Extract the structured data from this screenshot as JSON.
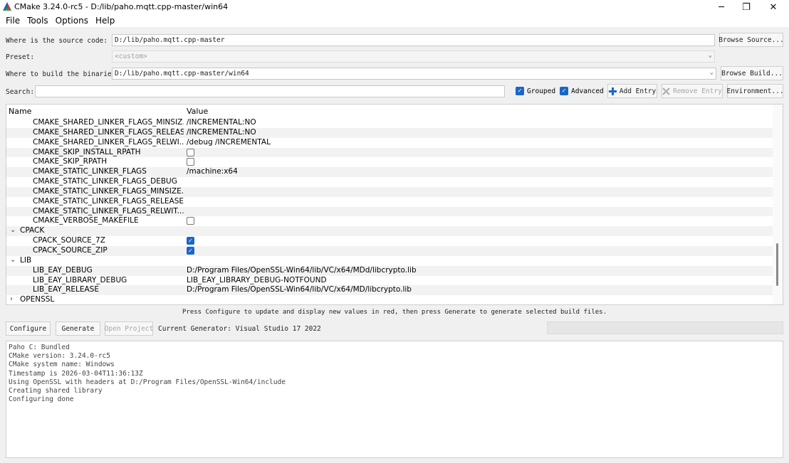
{
  "window": {
    "title": "CMake 3.24.0-rc5 - D:/lib/paho.mqtt.cpp-master/win64",
    "min_glyph": "─",
    "max_glyph": "❐",
    "close_glyph": "✕"
  },
  "menu": [
    "File",
    "Tools",
    "Options",
    "Help"
  ],
  "source": {
    "label": "Where is the source code:",
    "value": "D:/lib/paho.mqtt.cpp-master",
    "button": "Browse Source..."
  },
  "preset": {
    "label": "Preset:",
    "value": "<custom>"
  },
  "build": {
    "label": "Where to build the binaries:",
    "value": "D:/lib/paho.mqtt.cpp-master/win64",
    "button": "Browse Build..."
  },
  "search": {
    "label": "Search:",
    "value": ""
  },
  "toggles": {
    "grouped": "Grouped",
    "advanced": "Advanced"
  },
  "toolbar": {
    "add_entry": "Add Entry",
    "remove_entry": "Remove Entry",
    "environment": "Environment..."
  },
  "table": {
    "header_name": "Name",
    "header_value": "Value",
    "rows": [
      {
        "name": "CMAKE_SHARED_LINKER_FLAGS_MINSIZ...",
        "value": "/INCREMENTAL:NO"
      },
      {
        "name": "CMAKE_SHARED_LINKER_FLAGS_RELEASE",
        "value": "/INCREMENTAL:NO"
      },
      {
        "name": "CMAKE_SHARED_LINKER_FLAGS_RELWI...",
        "value": "/debug /INCREMENTAL"
      },
      {
        "name": "CMAKE_SKIP_INSTALL_RPATH",
        "checkbox": false
      },
      {
        "name": "CMAKE_SKIP_RPATH",
        "checkbox": false
      },
      {
        "name": "CMAKE_STATIC_LINKER_FLAGS",
        "value": "/machine:x64"
      },
      {
        "name": "CMAKE_STATIC_LINKER_FLAGS_DEBUG",
        "value": ""
      },
      {
        "name": "CMAKE_STATIC_LINKER_FLAGS_MINSIZE...",
        "value": ""
      },
      {
        "name": "CMAKE_STATIC_LINKER_FLAGS_RELEASE",
        "value": ""
      },
      {
        "name": "CMAKE_STATIC_LINKER_FLAGS_RELWIT...",
        "value": ""
      },
      {
        "name": "CMAKE_VERBOSE_MAKEFILE",
        "checkbox": false
      },
      {
        "name": "CPACK",
        "group": true,
        "expanded": true
      },
      {
        "name": "CPACK_SOURCE_7Z",
        "checkbox": true
      },
      {
        "name": "CPACK_SOURCE_ZIP",
        "checkbox": true
      },
      {
        "name": "LIB",
        "group": true,
        "expanded": true
      },
      {
        "name": "LIB_EAY_DEBUG",
        "value": "D:/Program Files/OpenSSL-Win64/lib/VC/x64/MDd/libcrypto.lib"
      },
      {
        "name": "LIB_EAY_LIBRARY_DEBUG",
        "value": "LIB_EAY_LIBRARY_DEBUG-NOTFOUND"
      },
      {
        "name": "LIB_EAY_RELEASE",
        "value": "D:/Program Files/OpenSSL-Win64/lib/VC/x64/MD/libcrypto.lib"
      },
      {
        "name": "OPENSSL",
        "group": true,
        "expanded": false
      }
    ]
  },
  "hint": "Press Configure to update and display new values in red, then press Generate to generate selected build files.",
  "actions": {
    "configure": "Configure",
    "generate": "Generate",
    "open_project": "Open Project",
    "generator": "Current Generator: Visual Studio 17 2022"
  },
  "output": [
    "Paho C: Bundled",
    "CMake version: 3.24.0-rc5",
    "CMake system name: Windows",
    "Timestamp is 2026-03-04T11:36:13Z",
    "Using OpenSSL with headers at D:/Program Files/OpenSSL-Win64/include",
    "Creating shared library",
    "Configuring done"
  ],
  "colors": {
    "accent": "#1a67c7"
  }
}
